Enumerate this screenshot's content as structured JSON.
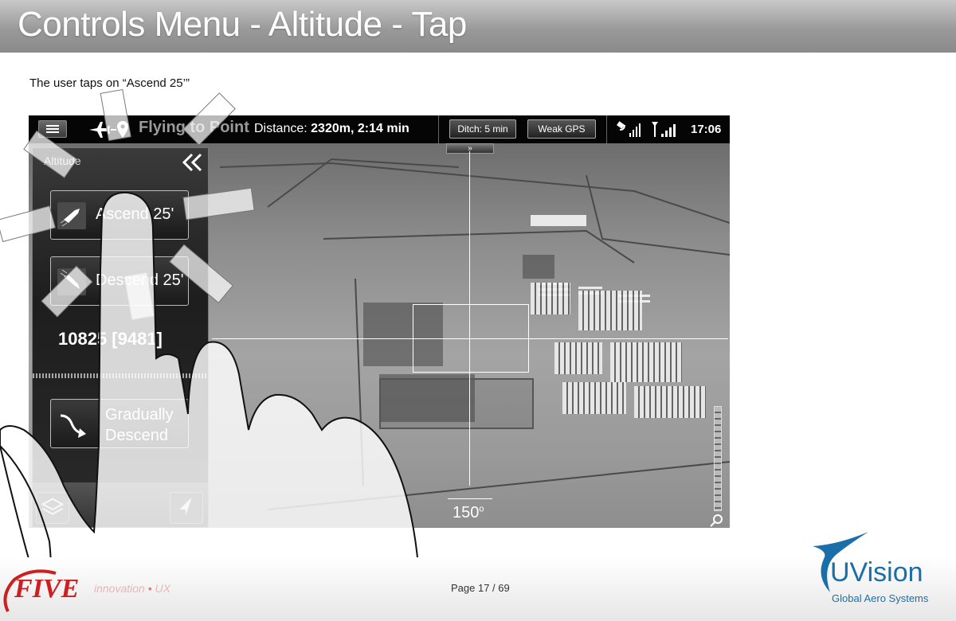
{
  "slide": {
    "title": "Controls Menu - Altitude - Tap",
    "caption": "The user taps on “Ascend 25’”",
    "page": "Page 17 / 69"
  },
  "topbar": {
    "menu_icon": "hamburger-icon",
    "mode_icon": "plane-to-point-icon",
    "mode_text": "Flying to Point",
    "distance_label": "Distance:",
    "distance_value": "2320m,",
    "time_value": "2:14 min",
    "ditch_label": "Ditch: 5 min",
    "gps_label": "Weak GPS",
    "satellite_icon": "satellite-signal-icon",
    "radio_icon": "radio-signal-icon",
    "clock": "17:06"
  },
  "altitude_panel": {
    "title": "Altitude",
    "ascend_label": "Ascend 25'",
    "descend_label": "Descend 25'",
    "altitude_value": "10825 [9481]",
    "gradual_label_1": "Gradually",
    "gradual_label_2": "Descend"
  },
  "video": {
    "heading": "150",
    "heading_unit": "o",
    "chevron": "»"
  },
  "footer": {
    "tagline_1": "innovation",
    "tagline_sep": "•",
    "tagline_2": "UX",
    "five_logo_text": "FIVE",
    "uvision_name": "UVision",
    "uvision_sub": "Global Aero Systems"
  },
  "colors": {
    "header_gradient": "#9a9a9a",
    "uvision_blue": "#1b6fa8",
    "five_red": "#cc1f1f"
  }
}
